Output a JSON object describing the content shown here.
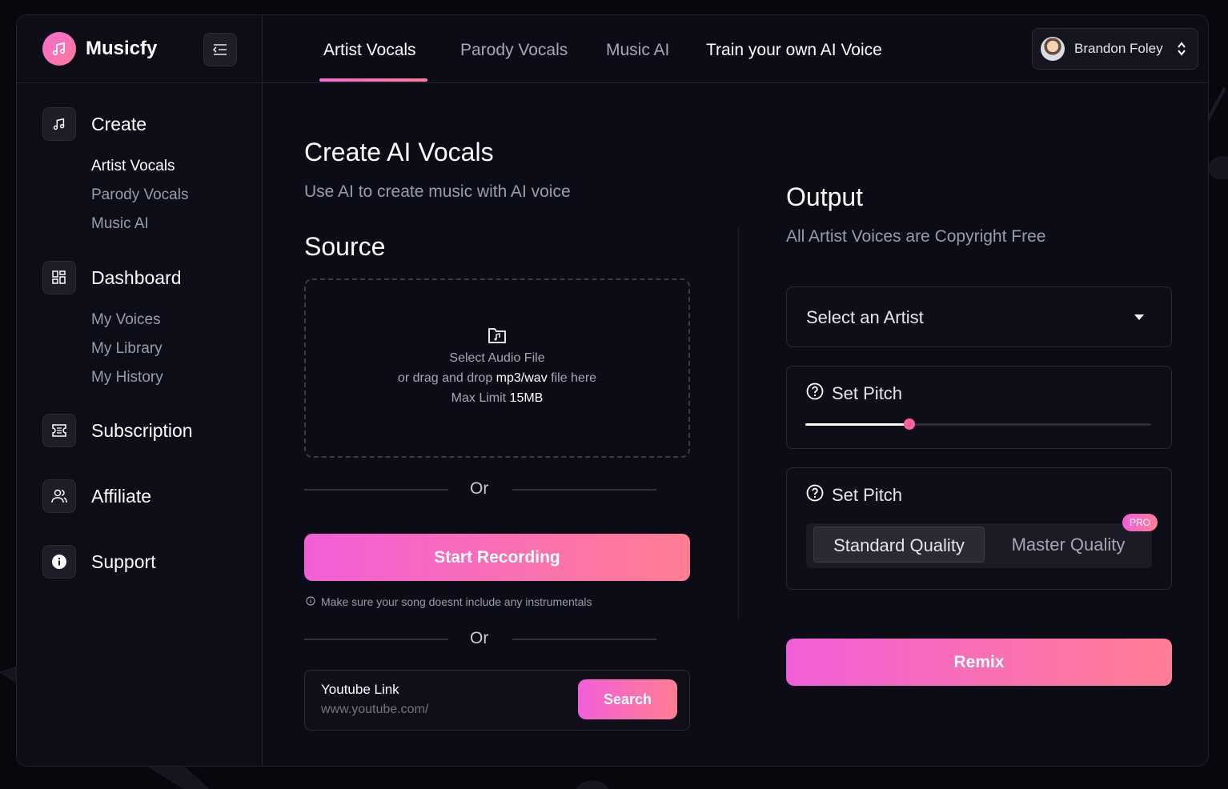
{
  "brand": {
    "name": "Musicfy"
  },
  "sidebar": {
    "sections": [
      {
        "title": "Create",
        "items": [
          "Artist Vocals",
          "Parody Vocals",
          "Music AI"
        ]
      },
      {
        "title": "Dashboard",
        "items": [
          "My Voices",
          "My Library",
          "My History"
        ]
      },
      {
        "title": "Subscription"
      },
      {
        "title": "Affiliate"
      },
      {
        "title": "Support"
      }
    ]
  },
  "tabs": [
    "Artist Vocals",
    "Parody Vocals",
    "Music AI",
    "Train your own AI Voice"
  ],
  "user": {
    "name": "Brandon Foley"
  },
  "create": {
    "title": "Create AI Vocals",
    "subtitle": "Use AI to create music with AI voice",
    "source_title": "Source",
    "drop_line1": "Select Audio File",
    "drop_line2_pre": "or drag and drop ",
    "drop_line2_bold": "mp3/wav",
    "drop_line2_post": " file here",
    "drop_line3_pre": "Max Limit ",
    "drop_line3_bold": "15MB",
    "or": "Or",
    "record_label": "Start Recording",
    "note": "Make sure your song doesnt include any instrumentals",
    "youtube_label": "Youtube Link",
    "youtube_placeholder": "www.youtube.com/",
    "search_label": "Search"
  },
  "output": {
    "title": "Output",
    "subtitle": "All Artist Voices are Copyright Free",
    "select_placeholder": "Select an Artist",
    "pitch_title": "Set Pitch",
    "pitch_value": 0.3,
    "quality_title": "Set Pitch",
    "quality_options": [
      "Standard Quality",
      "Master Quality"
    ],
    "quality_selected": "Standard Quality",
    "pro_badge": "PRO",
    "remix_label": "Remix"
  },
  "colors": {
    "accent_start": "#f15fd8",
    "accent_end": "#ff7e93",
    "background": "#0c0c17"
  }
}
